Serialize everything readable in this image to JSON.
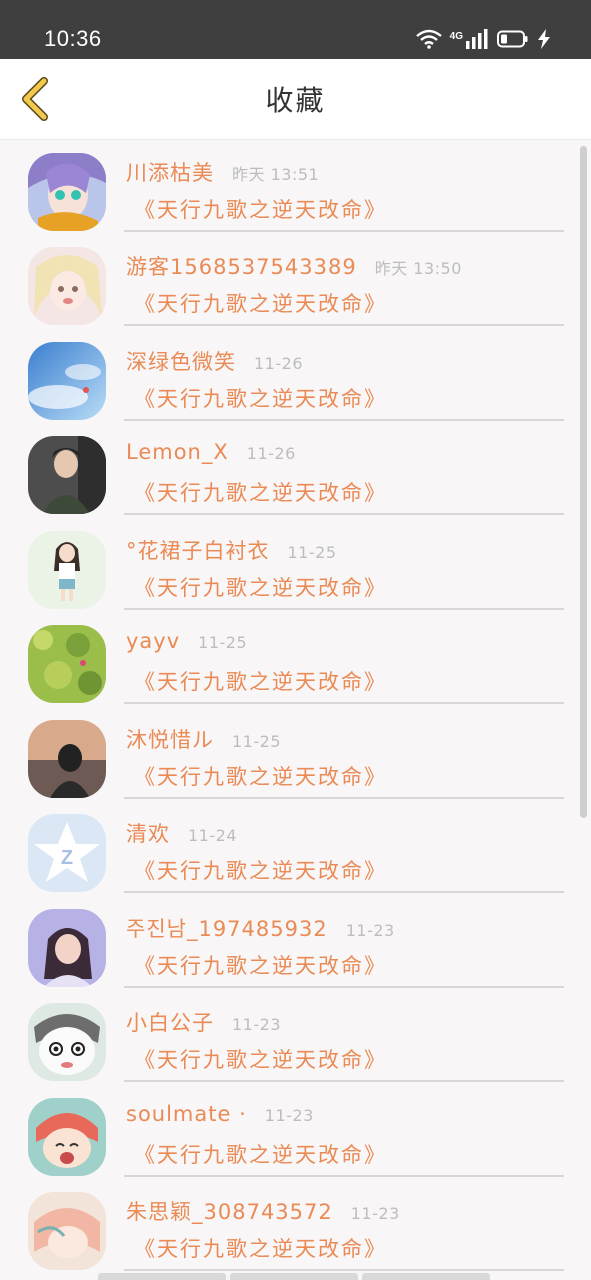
{
  "status_bar": {
    "time": "10:36",
    "network": "4G"
  },
  "header": {
    "title": "收藏"
  },
  "favorites": [
    {
      "name": "川添枯美",
      "date": "昨天 13:51",
      "book": "《天行九歌之逆天改命》"
    },
    {
      "name": "游客1568537543389",
      "date": "昨天 13:50",
      "book": "《天行九歌之逆天改命》"
    },
    {
      "name": "深绿色微笑",
      "date": "11-26",
      "book": "《天行九歌之逆天改命》"
    },
    {
      "name": "Lemon_X",
      "date": "11-26",
      "book": "《天行九歌之逆天改命》"
    },
    {
      "name": "°花裙子白衬衣",
      "date": "11-25",
      "book": "《天行九歌之逆天改命》"
    },
    {
      "name": "yayv",
      "date": "11-25",
      "book": "《天行九歌之逆天改命》"
    },
    {
      "name": "沐悦惜ル",
      "date": "11-25",
      "book": "《天行九歌之逆天改命》"
    },
    {
      "name": "清欢",
      "date": "11-24",
      "book": "《天行九歌之逆天改命》"
    },
    {
      "name": "주진남_197485932",
      "date": "11-23",
      "book": "《天行九歌之逆天改命》"
    },
    {
      "name": "小白公子",
      "date": "11-23",
      "book": "《天行九歌之逆天改命》"
    },
    {
      "name": "soulmate ·",
      "date": "11-23",
      "book": "《天行九歌之逆天改命》"
    },
    {
      "name": "朱思颖_308743572",
      "date": "11-23",
      "book": "《天行九歌之逆天改命》"
    }
  ],
  "colors": {
    "accent": "#ea8a54",
    "date_gray": "#bdbdbd",
    "back_arrow": "#f2c94c"
  },
  "icons": [
    "wifi-icon",
    "signal-icon",
    "battery-icon",
    "charging-icon",
    "back-arrow-icon"
  ]
}
